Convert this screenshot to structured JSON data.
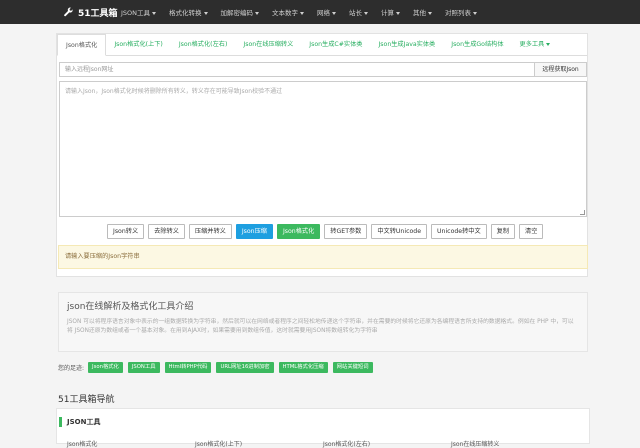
{
  "nav": {
    "brand": "51工具箱",
    "items": [
      {
        "label": "JSON工具",
        "dropdown": true
      },
      {
        "label": "格式化转换",
        "dropdown": true
      },
      {
        "label": "加解密编码",
        "dropdown": true
      },
      {
        "label": "文本数字",
        "dropdown": true
      },
      {
        "label": "网络",
        "dropdown": true
      },
      {
        "label": "站长",
        "dropdown": true
      },
      {
        "label": "计算",
        "dropdown": true
      },
      {
        "label": "其他",
        "dropdown": true
      },
      {
        "label": "对照列表",
        "dropdown": true
      }
    ]
  },
  "tabs": [
    {
      "label": "Json格式化"
    },
    {
      "label": "Json格式化(上下)"
    },
    {
      "label": "Json格式化(左右)"
    },
    {
      "label": "Json在线压缩转义"
    },
    {
      "label": "Json生成C#实体类"
    },
    {
      "label": "Json生成Java实体类"
    },
    {
      "label": "Json生成Go结构体"
    },
    {
      "label": "更多工具"
    }
  ],
  "url_input": {
    "placeholder": "输入远程Json网址",
    "button": "远程获取Json"
  },
  "json_area": {
    "placeholder": "请输入Json，Json格式化时候将删除所有转义，转义存在可能导致Json校验不通过"
  },
  "buttons": [
    {
      "label": "Json转义",
      "style": "default"
    },
    {
      "label": "去除转义",
      "style": "default"
    },
    {
      "label": "压缩并转义",
      "style": "default"
    },
    {
      "label": "Json压缩",
      "style": "blue"
    },
    {
      "label": "Json格式化",
      "style": "green"
    },
    {
      "label": "转GET参数",
      "style": "default"
    },
    {
      "label": "中文转Unicode",
      "style": "default"
    },
    {
      "label": "Unicode转中文",
      "style": "default"
    },
    {
      "label": "复制",
      "style": "default"
    },
    {
      "label": "清空",
      "style": "default"
    }
  ],
  "notice": "请输入要压缩的Json字符串",
  "intro": {
    "title": "json在线解析及格式化工具介绍",
    "text": "JSON 可以将程序语言对象中表示的一组数据转换为字符串，然后就可以在网络或者程序之间轻松地传递这个字符串，并在需要的时候将它还原为各编程语言所支持的数据格式。例如在 PHP 中，可以将 JSON还原为数组或者一个基本对象。在用到AJAX时，如果需要用到数组传值，这时就需要用JSON将数组转化为字符串"
  },
  "like": {
    "label": "您的足迹:",
    "tags": [
      "Json格式化",
      "JSON工具",
      "Html转PHP代码",
      "URL网址16进制加密",
      "HTML格式化压缩",
      "网站关键短词"
    ]
  },
  "site_nav": {
    "title": "51工具箱导航",
    "section": "JSON工具",
    "links": [
      "Json格式化",
      "Json格式化(上下)",
      "Json格式化(左右)",
      "Json在线压缩转义"
    ]
  },
  "colors": {
    "navbar": "#2d2d2d",
    "accent_green": "#3cb95f",
    "accent_blue": "#1e9fe0"
  }
}
